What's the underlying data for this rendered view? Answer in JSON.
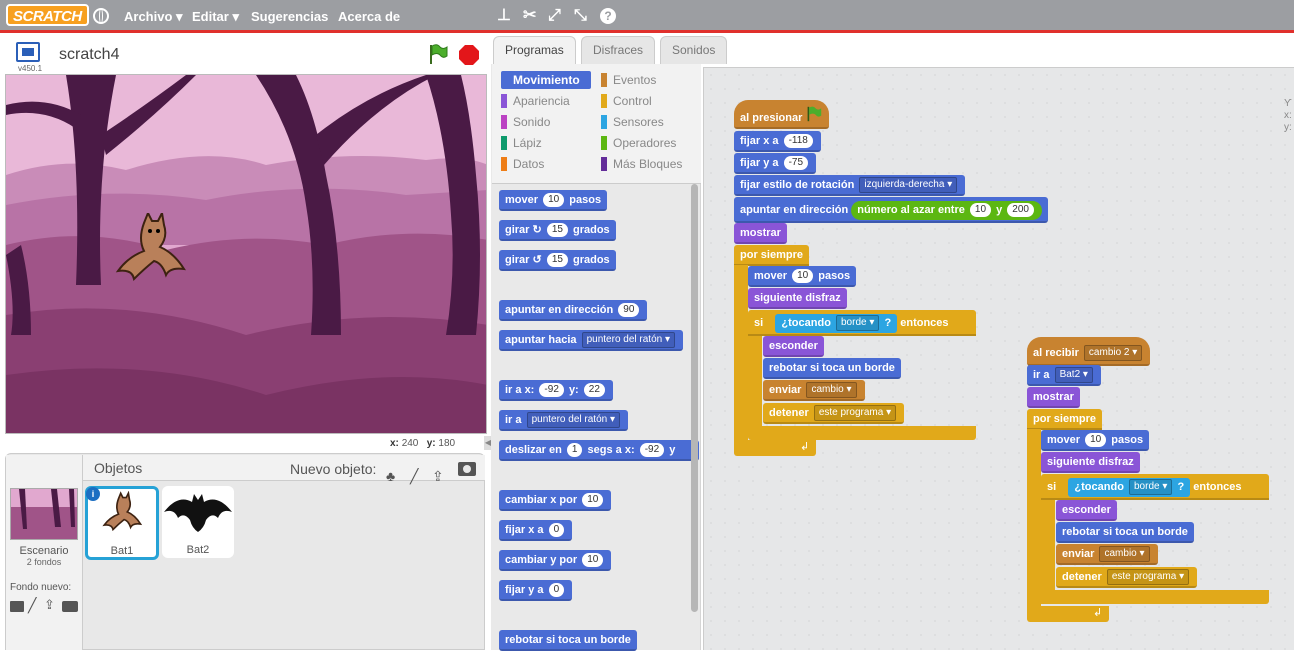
{
  "topbar": {
    "logo": "SCRATCH",
    "menus": [
      "Archivo ▾",
      "Editar ▾",
      "Sugerencias",
      "Acerca de"
    ]
  },
  "stage": {
    "title": "scratch4",
    "version": "v450.1",
    "coords": {
      "x_label": "x:",
      "x": "240",
      "y_label": "y:",
      "y": "180"
    }
  },
  "sprites": {
    "header": "Objetos",
    "new_label": "Nuevo objeto:",
    "stage_label": "Escenario",
    "stage_count": "2 fondos",
    "backdrop_label": "Fondo nuevo:",
    "items": [
      "Bat1",
      "Bat2"
    ]
  },
  "tabs": [
    "Programas",
    "Disfraces",
    "Sonidos"
  ],
  "categories": {
    "left": [
      "Movimiento",
      "Apariencia",
      "Sonido",
      "Lápiz",
      "Datos"
    ],
    "right": [
      "Eventos",
      "Control",
      "Sensores",
      "Operadores",
      "Más Bloques"
    ]
  },
  "palette": {
    "move": "mover",
    "move_val": "10",
    "move_unit": "pasos",
    "turn_r": "girar",
    "turn_r_val": "15",
    "turn_unit": "grados",
    "turn_l": "girar",
    "turn_l_val": "15",
    "point_dir": "apuntar en dirección",
    "point_dir_val": "90",
    "point_to": "apuntar hacia",
    "point_to_val": "puntero del ratón",
    "goto_xy": "ir a x:",
    "goto_x": "-92",
    "goto_y_label": "y:",
    "goto_y": "22",
    "goto": "ir a",
    "goto_val": "puntero del ratón",
    "glide": "deslizar en",
    "glide_secs": "1",
    "glide_mid": "segs a x:",
    "glide_x": "-92",
    "glide_y": "y",
    "change_x": "cambiar x por",
    "change_x_val": "10",
    "set_x": "fijar x a",
    "set_x_val": "0",
    "change_y": "cambiar y por",
    "change_y_val": "10",
    "set_y": "fijar y a",
    "set_y_val": "0",
    "bounce": "rebotar si toca un borde"
  },
  "script1": {
    "hat": "al presionar",
    "setx": "fijar x a",
    "setx_val": "-118",
    "sety": "fijar y a",
    "sety_val": "-75",
    "rot": "fijar estilo de rotación",
    "rot_val": "izquierda-derecha",
    "point": "apuntar en dirección",
    "rand": "número al azar entre",
    "rand_a": "10",
    "rand_and": "y",
    "rand_b": "200",
    "show": "mostrar",
    "forever": "por siempre",
    "move": "mover",
    "move_val": "10",
    "move_unit": "pasos",
    "next": "siguiente disfraz",
    "if": "si",
    "touch": "¿tocando",
    "touch_val": "borde",
    "touch_q": "?",
    "then": "entonces",
    "hide": "esconder",
    "bounce": "rebotar si toca un borde",
    "broadcast": "enviar",
    "broadcast_val": "cambio",
    "stop": "detener",
    "stop_val": "este programa"
  },
  "script2": {
    "hat": "al recibir",
    "hat_val": "cambio 2",
    "goto": "ir a",
    "goto_val": "Bat2",
    "show": "mostrar",
    "forever": "por siempre",
    "move": "mover",
    "move_val": "10",
    "move_unit": "pasos",
    "next": "siguiente disfraz",
    "if": "si",
    "touch": "¿tocando",
    "touch_val": "borde",
    "touch_q": "?",
    "then": "entonces",
    "hide": "esconder",
    "bounce": "rebotar si toca un borde",
    "broadcast": "enviar",
    "broadcast_val": "cambio",
    "stop": "detener",
    "stop_val": "este programa"
  }
}
